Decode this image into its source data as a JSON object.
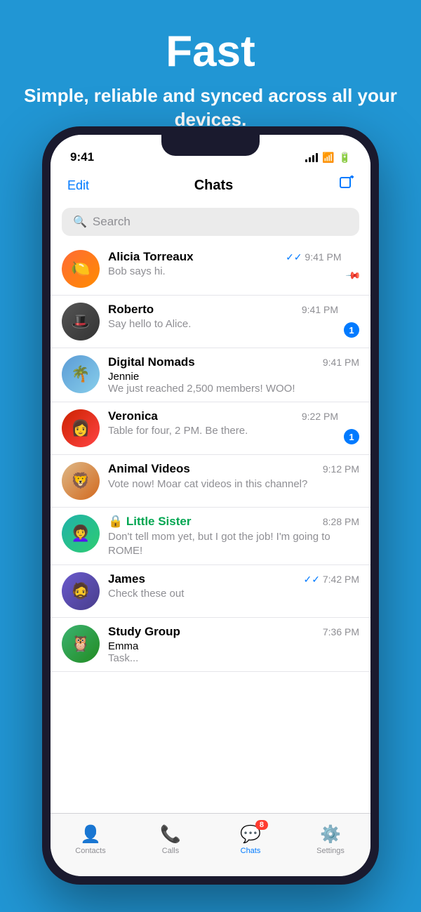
{
  "hero": {
    "title": "Fast",
    "subtitle": "Simple, reliable and synced across all your devices."
  },
  "phone": {
    "status_bar": {
      "time": "9:41"
    },
    "nav": {
      "edit_label": "Edit",
      "title": "Chats",
      "compose_symbol": "✏"
    },
    "search": {
      "placeholder": "Search"
    },
    "chats": [
      {
        "id": "alicia",
        "name": "Alicia Torreaux",
        "preview": "Bob says hi.",
        "time": "9:41 PM",
        "has_double_tick": true,
        "pinned": true,
        "badge": null,
        "avatar_emoji": "🍋",
        "avatar_class": "avatar-alicia",
        "is_locked": false,
        "sender": null
      },
      {
        "id": "roberto",
        "name": "Roberto",
        "preview": "Say hello to Alice.",
        "time": "9:41 PM",
        "has_double_tick": false,
        "pinned": false,
        "badge": "1",
        "avatar_emoji": "🎩",
        "avatar_class": "avatar-roberto",
        "is_locked": false,
        "sender": null
      },
      {
        "id": "digital",
        "name": "Digital Nomads",
        "preview": "We just reached 2,500 members! WOO!",
        "time": "9:41 PM",
        "has_double_tick": false,
        "pinned": false,
        "badge": null,
        "avatar_emoji": "🌴",
        "avatar_class": "avatar-digital",
        "is_locked": false,
        "sender": "Jennie"
      },
      {
        "id": "veronica",
        "name": "Veronica",
        "preview": "Table for four, 2 PM. Be there.",
        "time": "9:22 PM",
        "has_double_tick": false,
        "pinned": false,
        "badge": "1",
        "avatar_emoji": "👩",
        "avatar_class": "avatar-veronica",
        "is_locked": false,
        "sender": null
      },
      {
        "id": "animal",
        "name": "Animal Videos",
        "preview": "Vote now! Moar cat videos in this channel?",
        "time": "9:12 PM",
        "has_double_tick": false,
        "pinned": false,
        "badge": null,
        "avatar_emoji": "🦁",
        "avatar_class": "avatar-animal",
        "is_locked": false,
        "sender": null
      },
      {
        "id": "sister",
        "name": "Little Sister",
        "preview": "Don't tell mom yet, but I got the job! I'm going to ROME!",
        "time": "8:28 PM",
        "has_double_tick": false,
        "pinned": false,
        "badge": null,
        "avatar_emoji": "👩‍🦱",
        "avatar_class": "avatar-sister",
        "is_locked": true,
        "sender": null
      },
      {
        "id": "james",
        "name": "James",
        "preview": "Check these out",
        "time": "7:42 PM",
        "has_double_tick": true,
        "pinned": false,
        "badge": null,
        "avatar_emoji": "🧔",
        "avatar_class": "avatar-james",
        "is_locked": false,
        "sender": null
      },
      {
        "id": "study",
        "name": "Study Group",
        "preview": "Task...",
        "time": "7:36 PM",
        "has_double_tick": false,
        "pinned": false,
        "badge": null,
        "avatar_emoji": "🦉",
        "avatar_class": "avatar-study",
        "is_locked": false,
        "sender": "Emma"
      }
    ],
    "tab_bar": {
      "items": [
        {
          "id": "contacts",
          "label": "Contacts",
          "icon": "👤",
          "active": false
        },
        {
          "id": "calls",
          "label": "Calls",
          "icon": "📞",
          "active": false
        },
        {
          "id": "chats",
          "label": "Chats",
          "icon": "💬",
          "active": true,
          "badge": "8"
        },
        {
          "id": "settings",
          "label": "Settings",
          "icon": "⚙️",
          "active": false
        }
      ]
    }
  }
}
